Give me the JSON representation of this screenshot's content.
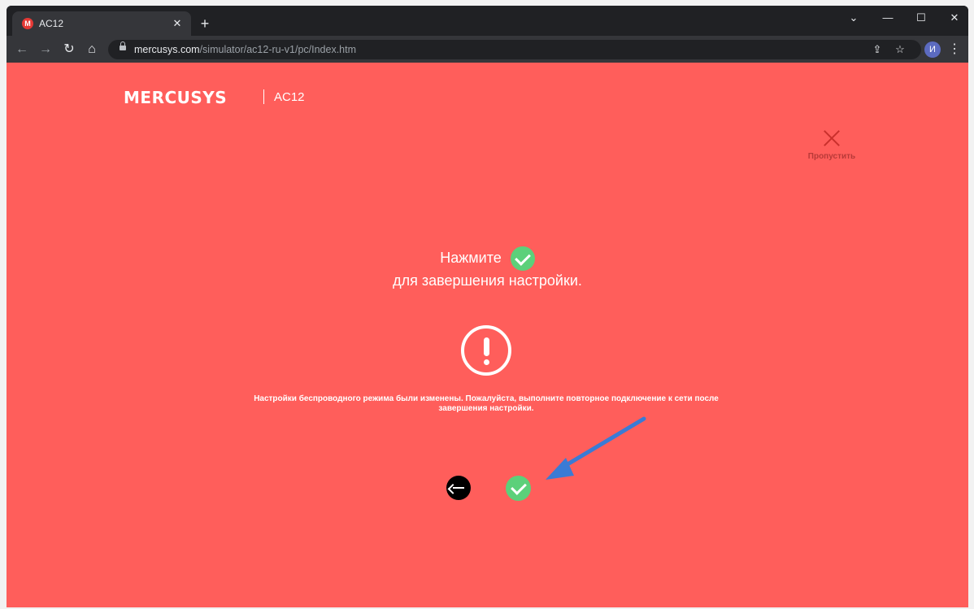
{
  "browser": {
    "tab_title": "AC12",
    "tab_favicon_letter": "M",
    "url_host": "mercusys.com",
    "url_path": "/simulator/ac12-ru-v1/pc/Index.htm",
    "profile_initial": "И"
  },
  "header": {
    "brand": "MERCUSYS",
    "model": "AC12"
  },
  "skip": {
    "label": "Пропустить"
  },
  "main": {
    "instruction_line1": "Нажмите",
    "instruction_line2": "для завершения настройки.",
    "notice": "Настройки беспроводного режима были изменены. Пожалуйста, выполните повторное подключение к сети после завершения настройки."
  },
  "colors": {
    "page_background": "#ff5e5b",
    "confirm_green": "#5cd07a",
    "annotation_arrow": "#3a7bd5"
  },
  "icons": {
    "skip": "close-icon",
    "warning": "exclamation-circle-icon",
    "back": "arrow-left-icon",
    "confirm": "check-icon"
  }
}
